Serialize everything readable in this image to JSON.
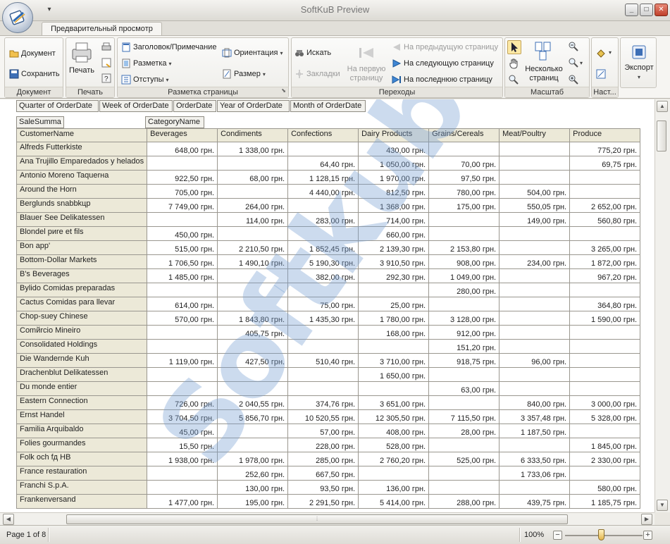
{
  "window": {
    "title": "SoftKuB Preview",
    "minimize_label": "_",
    "maximize_label": "□",
    "close_label": "✕",
    "qat_label": "▾"
  },
  "ribbon": {
    "tab_label": "Предварительный просмотр",
    "groups": {
      "document": {
        "label": "Документ",
        "open": "Документ",
        "save": "Сохранить"
      },
      "print": {
        "label": "Печать",
        "print": "Печать"
      },
      "layout": {
        "label": "Разметка страницы",
        "header_footer": "Заголовок/Примечание",
        "margins_menu": "Разметка",
        "indents": "Отступы",
        "orientation": "Ориентация",
        "size": "Размер"
      },
      "navigation": {
        "label": "Переходы",
        "find": "Искать",
        "bookmarks": "Закладки",
        "first_page_1": "На первую",
        "first_page_2": "страницу",
        "prev_page": "На предыдущую страницу",
        "next_page": "На следующую страницу",
        "last_page": "На последнюю страницу"
      },
      "zoom": {
        "label": "Масштаб",
        "multi_1": "Несколько",
        "multi_2": "страниц"
      },
      "settings": {
        "label": "Наст..."
      },
      "export": {
        "label": "Экспорт"
      }
    }
  },
  "pivot": {
    "filter_fields": [
      "Quarter of OrderDate",
      "Week of OrderDate",
      "OrderDate",
      "Year of OrderDate",
      "Month of OrderDate"
    ],
    "data_field": "SaleSumma",
    "column_field": "CategoryName",
    "row_field": "CustomerName",
    "columns": [
      "Beverages",
      "Condiments",
      "Confections",
      "Dairy Products",
      "Grains/Cereals",
      "Meat/Poultry",
      "Produce"
    ],
    "rows": [
      {
        "name": "Alfreds Futterkiste",
        "values": [
          "648,00 грн.",
          "1 338,00 грн.",
          "",
          "430,00 грн.",
          "",
          "",
          "775,20 грн."
        ]
      },
      {
        "name": "Ana Trujillo Emparedados y helados",
        "values": [
          "",
          "",
          "64,40 грн.",
          "1 050,00 грн.",
          "70,00 грн.",
          "",
          "69,75 грн."
        ]
      },
      {
        "name": "Antonio Moreno Taquerнa",
        "values": [
          "922,50 грн.",
          "68,00 грн.",
          "1 128,15 грн.",
          "1 970,00 грн.",
          "97,50 грн.",
          "",
          ""
        ]
      },
      {
        "name": "Around the Horn",
        "values": [
          "705,00 грн.",
          "",
          "4 440,00 грн.",
          "812,50 грн.",
          "780,00 грн.",
          "504,00 грн.",
          ""
        ]
      },
      {
        "name": "Berglunds snabbkцp",
        "values": [
          "7 749,00 грн.",
          "264,00 грн.",
          "",
          "1 368,00 грн.",
          "175,00 грн.",
          "550,05 грн.",
          "2 652,00 грн."
        ]
      },
      {
        "name": "Blauer See Delikatessen",
        "values": [
          "",
          "114,00 грн.",
          "283,00 грн.",
          "714,00 грн.",
          "",
          "149,00 грн.",
          "560,80 грн."
        ]
      },
      {
        "name": "Blondel pиre et fils",
        "values": [
          "450,00 грн.",
          "",
          "",
          "660,00 грн.",
          "",
          "",
          ""
        ]
      },
      {
        "name": "Bon app'",
        "values": [
          "515,00 грн.",
          "2 210,50 грн.",
          "1 852,45 грн.",
          "2 139,30 грн.",
          "2 153,80 грн.",
          "",
          "3 265,00 грн."
        ]
      },
      {
        "name": "Bottom-Dollar Markets",
        "values": [
          "1 706,50 грн.",
          "1 490,10 грн.",
          "5 190,30 грн.",
          "3 910,50 грн.",
          "908,00 грн.",
          "234,00 грн.",
          "1 872,00 грн."
        ]
      },
      {
        "name": "B's Beverages",
        "values": [
          "1 485,00 грн.",
          "",
          "382,00 грн.",
          "292,30 грн.",
          "1 049,00 грн.",
          "",
          "967,20 грн."
        ]
      },
      {
        "name": "Bylido Comidas preparadas",
        "values": [
          "",
          "",
          "",
          "",
          "280,00 грн.",
          "",
          ""
        ]
      },
      {
        "name": "Cactus Comidas para llevar",
        "values": [
          "614,00 грн.",
          "",
          "75,00 грн.",
          "25,00 грн.",
          "",
          "",
          "364,80 грн."
        ]
      },
      {
        "name": "Chop-suey Chinese",
        "values": [
          "570,00 грн.",
          "1 843,80 грн.",
          "1 435,30 грн.",
          "1 780,00 грн.",
          "3 128,00 грн.",
          "",
          "1 590,00 грн."
        ]
      },
      {
        "name": "Comйrcio Mineiro",
        "values": [
          "",
          "405,75 грн.",
          "",
          "168,00 грн.",
          "912,00 грн.",
          "",
          ""
        ]
      },
      {
        "name": "Consolidated Holdings",
        "values": [
          "",
          "",
          "",
          "",
          "151,20 грн.",
          "",
          ""
        ]
      },
      {
        "name": "Die Wandernde Kuh",
        "values": [
          "1 119,00 грн.",
          "427,50 грн.",
          "510,40 грн.",
          "3 710,00 грн.",
          "918,75 грн.",
          "96,00 грн.",
          ""
        ]
      },
      {
        "name": "Drachenblut Delikatessen",
        "values": [
          "",
          "",
          "",
          "1 650,00 грн.",
          "",
          "",
          ""
        ]
      },
      {
        "name": "Du monde entier",
        "values": [
          "",
          "",
          "",
          "",
          "63,00 грн.",
          "",
          ""
        ]
      },
      {
        "name": "Eastern Connection",
        "values": [
          "726,00 грн.",
          "2 040,55 грн.",
          "374,76 грн.",
          "3 651,00 грн.",
          "",
          "840,00 грн.",
          "3 000,00 грн."
        ]
      },
      {
        "name": "Ernst Handel",
        "values": [
          "3 704,50 грн.",
          "5 856,70 грн.",
          "10 520,55 грн.",
          "12 305,50 грн.",
          "7 115,50 грн.",
          "3 357,48 грн.",
          "5 328,00 грн."
        ]
      },
      {
        "name": "Familia Arquibaldo",
        "values": [
          "45,00 грн.",
          "",
          "57,00 грн.",
          "408,00 грн.",
          "28,00 грн.",
          "1 187,50 грн.",
          ""
        ]
      },
      {
        "name": "Folies gourmandes",
        "values": [
          "15,50 грн.",
          "",
          "228,00 грн.",
          "528,00 грн.",
          "",
          "",
          "1 845,00 грн."
        ]
      },
      {
        "name": "Folk och fд HB",
        "values": [
          "1 938,00 грн.",
          "1 978,00 грн.",
          "285,00 грн.",
          "2 760,20 грн.",
          "525,00 грн.",
          "6 333,50 грн.",
          "2 330,00 грн."
        ]
      },
      {
        "name": "France restauration",
        "values": [
          "",
          "252,60 грн.",
          "667,50 грн.",
          "",
          "",
          "1 733,06 грн.",
          ""
        ]
      },
      {
        "name": "Franchi S.p.A.",
        "values": [
          "",
          "130,00 грн.",
          "93,50 грн.",
          "136,00 грн.",
          "",
          "",
          "580,00 грн."
        ]
      },
      {
        "name": "Frankenversand",
        "values": [
          "1 477,00 грн.",
          "195,00 грн.",
          "2 291,50 грн.",
          "5 414,00 грн.",
          "288,00 грн.",
          "439,75 грн.",
          "1 185,75 грн."
        ]
      }
    ]
  },
  "watermark": "Softkub",
  "status": {
    "page_info": "Page 1 of 8",
    "zoom": "100%",
    "zoom_level_percent": 100
  },
  "colors": {
    "header_bg": "#ece9d8",
    "watermark": "#78a0d2"
  }
}
